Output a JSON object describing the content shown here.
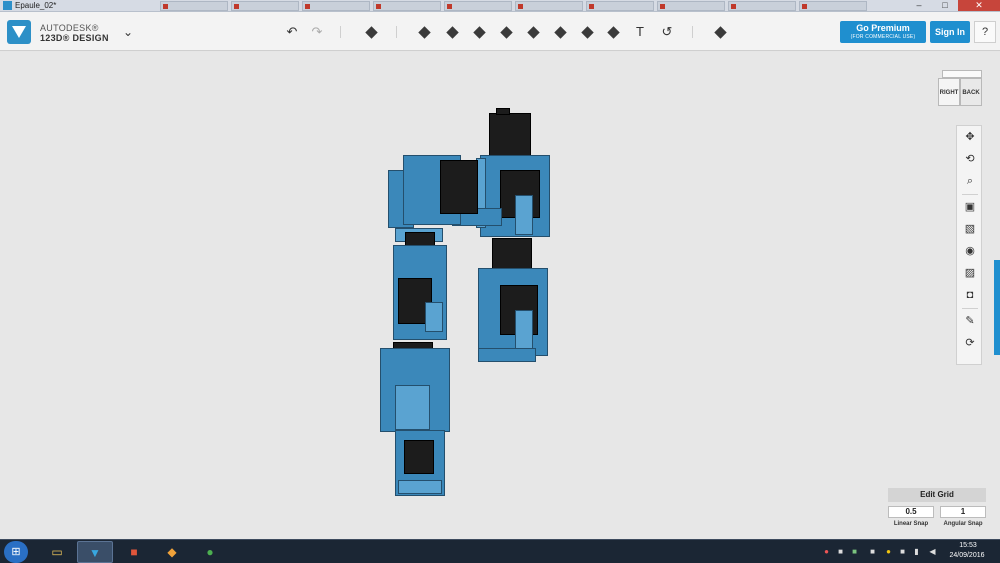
{
  "window": {
    "title": "Epaule_02*",
    "minimize_glyph": "–",
    "maximize_glyph": "□",
    "close_glyph": "✕",
    "background_tabs": [
      "",
      "",
      "",
      "",
      "",
      "",
      "",
      "",
      "",
      ""
    ]
  },
  "app": {
    "brand_top": "AUTODESK®",
    "brand_bottom": "123D® DESIGN",
    "menu_glyph": "⌄"
  },
  "toolbar": {
    "undo_glyph": "↶",
    "redo_glyph": "↷",
    "text_tool_glyph": "T",
    "magnet_glyph": "↺"
  },
  "account": {
    "premium_label": "Go Premium",
    "premium_sub": "(FOR COMMERCIAL USE)",
    "signin_label": "Sign In",
    "help_label": "?"
  },
  "viewcube": {
    "right": "RIGHT",
    "back": "BACK"
  },
  "nav_tools": {
    "pan_glyph": "✥",
    "orbit_glyph": "⟲",
    "zoom_glyph": "⌕",
    "fit_glyph": "▣",
    "view_glyph": "▧",
    "visibility_glyph": "◉",
    "hide_glyph": "▨",
    "screenshot_glyph": "◘",
    "material_glyph": "✎",
    "snap_glyph": "⟳"
  },
  "edit_grid": {
    "title": "Edit Grid",
    "linear_value": "0.5",
    "angular_value": "1",
    "linear_label": "Linear Snap",
    "angular_label": "Angular Snap"
  },
  "taskbar": {
    "start_glyph": "⊞",
    "time": "15:53",
    "date": "24/09/2016"
  },
  "colors": {
    "accent": "#1f8fcf",
    "model_blue": "#3b88ba",
    "model_dark": "#1c1c1c",
    "viewport_bg": "#e7e7e7",
    "taskbar_bg": "#1b2634"
  }
}
